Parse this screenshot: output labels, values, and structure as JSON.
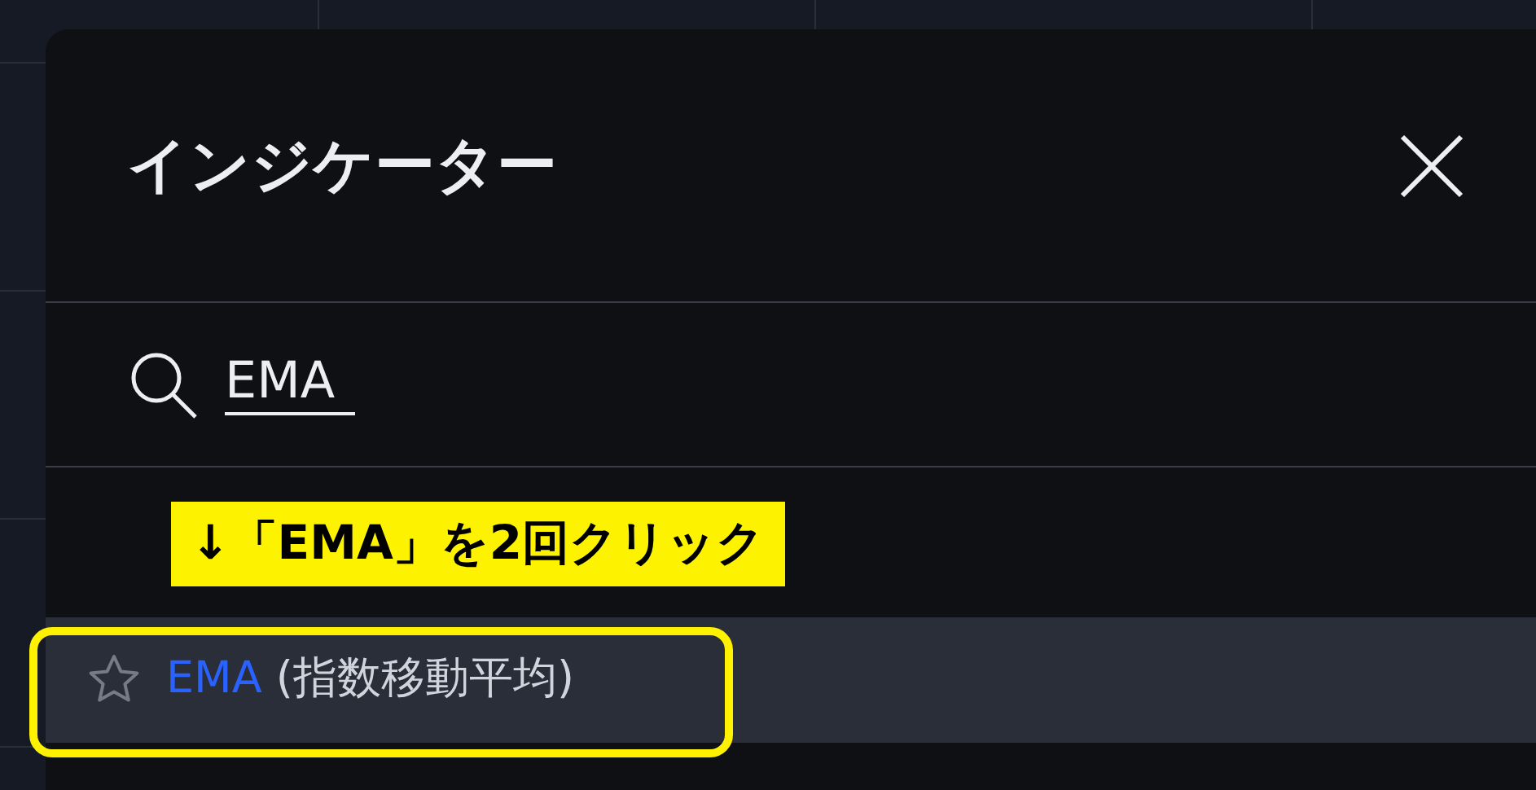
{
  "dialog": {
    "title": "インジケーター"
  },
  "search": {
    "value": "EMA"
  },
  "annotation": {
    "text": "↓「EMA」を2回クリック"
  },
  "results": [
    {
      "name": "EMA",
      "description": "(指数移動平均)",
      "selected": true,
      "favorite": false,
      "outlined": true
    }
  ]
}
